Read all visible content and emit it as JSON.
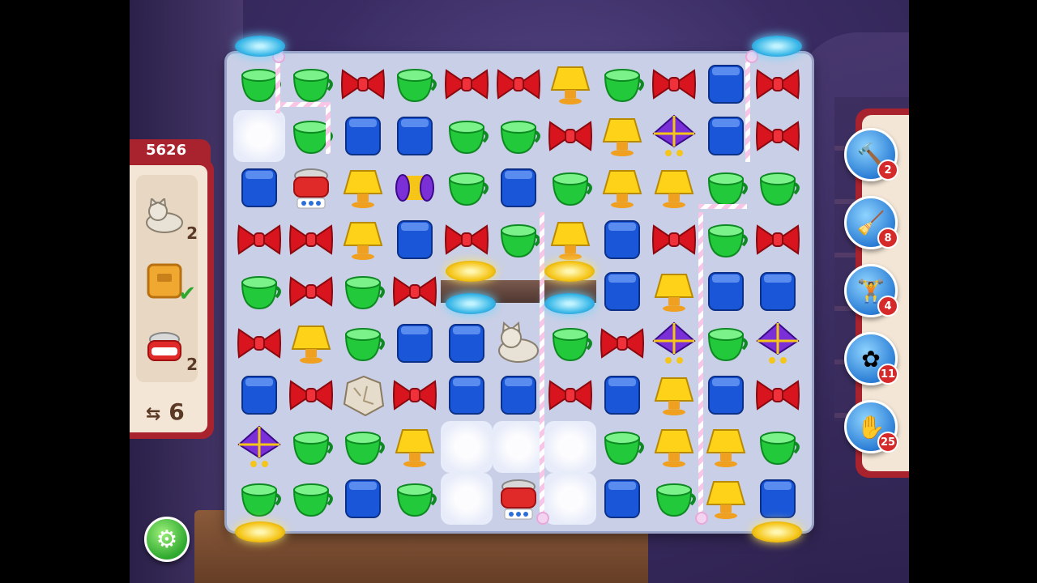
{
  "score": "5626",
  "goals": [
    {
      "icon": "cat-statue-icon",
      "count": "2"
    },
    {
      "icon": "crate-icon",
      "count": "",
      "done": true
    },
    {
      "icon": "cooking-pot-icon",
      "count": "2"
    }
  ],
  "moves": "6",
  "moves_icon": "swap-arrows-icon",
  "boosters": [
    {
      "icon": "hammer-icon",
      "count": "2"
    },
    {
      "icon": "broom-icon",
      "count": "8"
    },
    {
      "icon": "kettlebell-icon",
      "count": "4"
    },
    {
      "icon": "propeller-icon",
      "count": "11"
    },
    {
      "icon": "glove-icon",
      "count": "25"
    }
  ],
  "settings_icon": "gear-icon",
  "colors": {
    "green": "#22c93a",
    "red": "#d8141e",
    "blue": "#1a57d8",
    "yellow": "#ffd21a",
    "purple": "#7b2fd6",
    "panel": "#a8232e"
  },
  "grid": [
    [
      "green",
      "green",
      "bow",
      "green",
      "bow",
      "bow",
      "lamp",
      "green",
      "bow",
      "blue",
      "bow"
    ],
    [
      "fog",
      "green",
      "blue",
      "blue",
      "green",
      "green",
      "bow",
      "lamp",
      "kite",
      "blue",
      "bow"
    ],
    [
      "blue",
      "pot",
      "lamp",
      "spool",
      "green",
      "blue",
      "green",
      "lamp",
      "lamp",
      "green",
      "green"
    ],
    [
      "bow",
      "bow",
      "lamp",
      "blue",
      "bow",
      "green",
      "lamp",
      "blue",
      "bow",
      "green",
      "bow"
    ],
    [
      "green",
      "bow",
      "green",
      "bow",
      "gap",
      "gap",
      "gap",
      "blue",
      "lamp",
      "blue",
      "blue"
    ],
    [
      "bow",
      "lamp",
      "green",
      "blue",
      "blue",
      "cat",
      "green",
      "bow",
      "kite",
      "green",
      "kite"
    ],
    [
      "blue",
      "bow",
      "rock",
      "bow",
      "blue",
      "blue",
      "bow",
      "blue",
      "lamp",
      "blue",
      "bow"
    ],
    [
      "kite",
      "green",
      "green",
      "lamp",
      "fog",
      "fog",
      "fog",
      "green",
      "lamp",
      "lamp",
      "green"
    ],
    [
      "green",
      "green",
      "blue",
      "green",
      "fog",
      "pot",
      "fog",
      "blue",
      "green",
      "lamp",
      "blue"
    ]
  ]
}
